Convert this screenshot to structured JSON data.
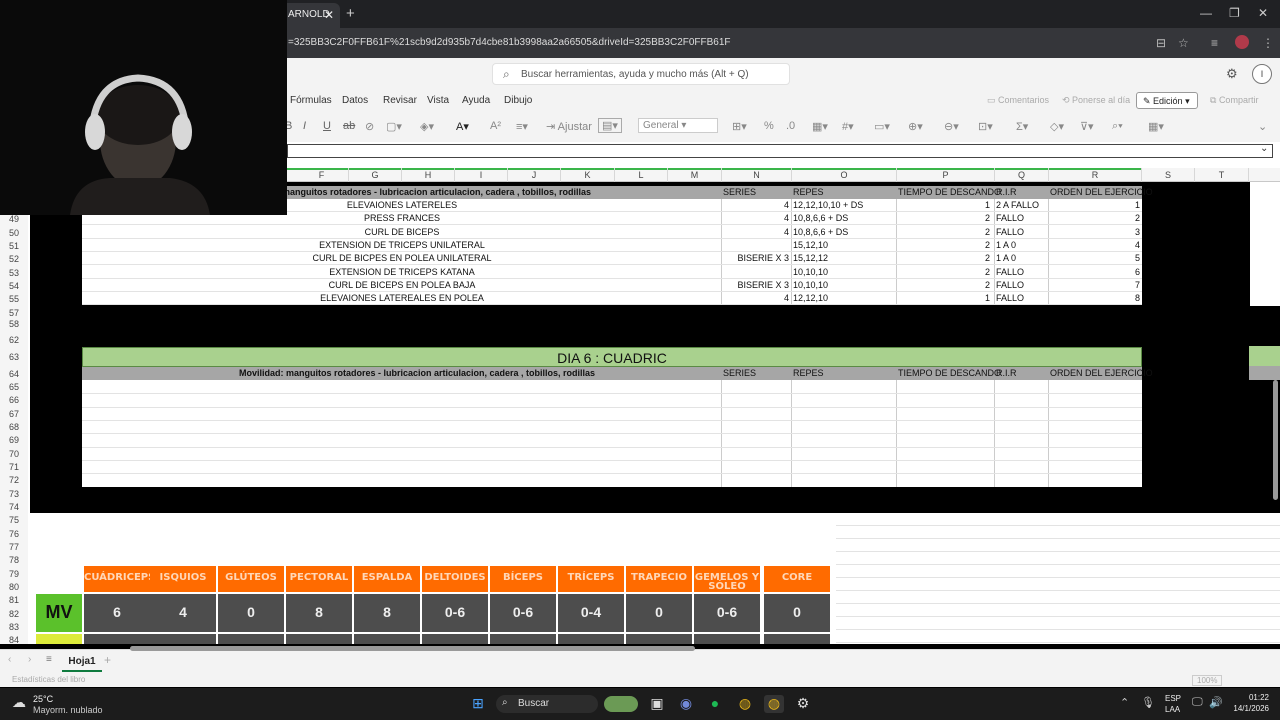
{
  "browser": {
    "tab_title": "ARNOLD",
    "tab_close": "✕",
    "new_tab": "+",
    "url": "=325BB3C2F0FFB61F%21scb9d2d935b7d4cbe81b3998aa2a66505&driveId=325BB3C2F0FFB61F"
  },
  "app": {
    "search_placeholder": "Buscar herramientas, ayuda y mucho más (Alt + Q)",
    "menu": [
      "Fórmulas",
      "Datos",
      "Revisar",
      "Vista",
      "Ayuda",
      "Dibujo"
    ],
    "comentarios": "Comentarios",
    "ponerse_al_dia": "Ponerse al día",
    "edicion": "Edición",
    "compartir": "Compartir",
    "wrap_label": "Ajustar",
    "number_format": "General"
  },
  "columns": [
    "F",
    "G",
    "H",
    "I",
    "J",
    "K",
    "L",
    "M",
    "N",
    "O",
    "P",
    "Q",
    "R",
    "S",
    "T"
  ],
  "rows_top": [
    "49",
    "50",
    "51",
    "52",
    "53",
    "54",
    "55",
    "57",
    "58",
    "62",
    "63",
    "64",
    "65",
    "66",
    "67",
    "68",
    "69",
    "70",
    "71",
    "72",
    "73",
    "74",
    "75",
    "76",
    "77",
    "78",
    "79",
    "80",
    "81",
    "82",
    "83",
    "84"
  ],
  "day5": {
    "mobility": "manguitos rotadores - lubricacion articulacion, cadera , tobillos, rodillas",
    "headers": {
      "series": "SERIES",
      "repes": "REPES",
      "descanso": "TIEMPO DE DESCANDO",
      "rir": "R.I.R",
      "orden": "ORDEN DEL EJERCICIO"
    },
    "rows": [
      {
        "name": "ELEVAIONES LATERELES",
        "series": "4",
        "repes": "12,12,10,10 + DS",
        "descanso": "1",
        "rir": "2 A FALLO",
        "orden": "1"
      },
      {
        "name": "PRESS FRANCES",
        "series": "4",
        "repes": "10,8,6,6 + DS",
        "descanso": "2",
        "rir": "FALLO",
        "orden": "2"
      },
      {
        "name": "CURL DE BICEPS",
        "series": "4",
        "repes": "10,8,6,6 + DS",
        "descanso": "2",
        "rir": "FALLO",
        "orden": "3"
      },
      {
        "name": "EXTENSION DE TRICEPS UNILATERAL",
        "series": "",
        "repes": "15,12,10",
        "descanso": "2",
        "rir": "1 A 0",
        "orden": "4"
      },
      {
        "name": "CURL DE BICPES EN POLEA UNILATERAL",
        "series": "BISERIE X 3",
        "repes": "15,12,12",
        "descanso": "2",
        "rir": "1 A 0",
        "orden": "5"
      },
      {
        "name": "EXTENSION DE TRICEPS KATANA",
        "series": "",
        "repes": "10,10,10",
        "descanso": "2",
        "rir": "FALLO",
        "orden": "6"
      },
      {
        "name": "CURL DE BICEPS EN POLEA BAJA",
        "series": "BISERIE X 3",
        "repes": "10,10,10",
        "descanso": "2",
        "rir": "FALLO",
        "orden": "7"
      },
      {
        "name": "ELEVAIONES LATEREALES EN POLEA",
        "series": "4",
        "repes": "12,12,10",
        "descanso": "1",
        "rir": "FALLO",
        "orden": "8"
      }
    ]
  },
  "day6": {
    "title": "DIA 6 : CUADRIC",
    "mobility": "Movilidad: manguitos rotadores - lubricacion articulacion, cadera , tobillos, rodillas",
    "headers": {
      "series": "SERIES",
      "repes": "REPES",
      "descanso": "TIEMPO DE DESCANDO",
      "rir": "R.I.R",
      "orden": "ORDEN DEL EJERCICIO"
    }
  },
  "stats": {
    "row_label": "MV",
    "muscles": [
      "CUÁDRICEPS",
      "ISQUIOS",
      "GLÚTEOS",
      "PECTORAL",
      "ESPALDA",
      "DELTOIDES",
      "BÍCEPS",
      "TRÍCEPS",
      "TRAPECIO",
      "GEMELOS Y SÓLEO",
      "CORE"
    ],
    "values": [
      "6",
      "4",
      "0",
      "8",
      "8",
      "0-6",
      "0-6",
      "0-4",
      "0",
      "0-6",
      "0"
    ]
  },
  "sheet_tab": "Hoja1",
  "status": {
    "left": "Estadísticas del libro",
    "zoom": "100%"
  },
  "taskbar": {
    "weather_temp": "25°C",
    "weather_desc": "Mayorm. nublado",
    "search": "Buscar",
    "lang": "ESP",
    "lang2": "LAA",
    "time": "01:22",
    "date": "14/1/2026"
  }
}
